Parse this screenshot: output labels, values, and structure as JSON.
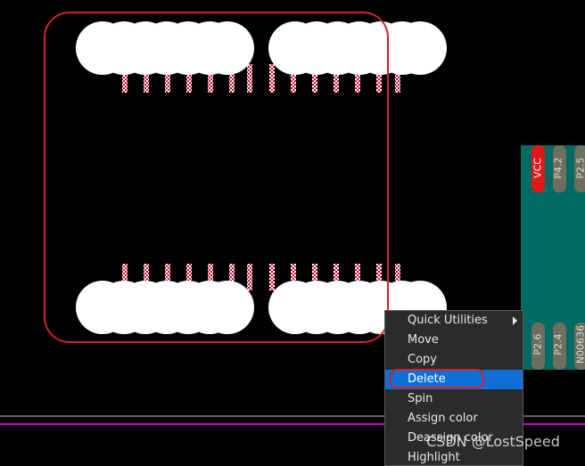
{
  "board": {
    "pad_labels_top": [
      "VCC",
      "P4.2",
      "P2.5"
    ],
    "pad_labels_bottom": [
      "P2.6",
      "P2.4",
      "N00636"
    ]
  },
  "context_menu": {
    "items": [
      {
        "label": "Quick Utilities",
        "has_submenu": true
      },
      {
        "label": "Move"
      },
      {
        "label": "Copy"
      },
      {
        "label": "Delete",
        "highlighted": true
      },
      {
        "label": "Spin"
      },
      {
        "label": "Assign color"
      },
      {
        "label": "Deassign color"
      },
      {
        "label": "Highlight"
      }
    ]
  },
  "watermark": "CSDN @LostSpeed",
  "colors": {
    "background": "#000000",
    "board": "#006b63",
    "vcc_pad": "#e01818",
    "pad": "#6e6e5e",
    "outline": "#d2222a",
    "trace": "#c800c8",
    "menu_bg": "#2b2b2b",
    "menu_highlight": "#0f6fd6"
  }
}
